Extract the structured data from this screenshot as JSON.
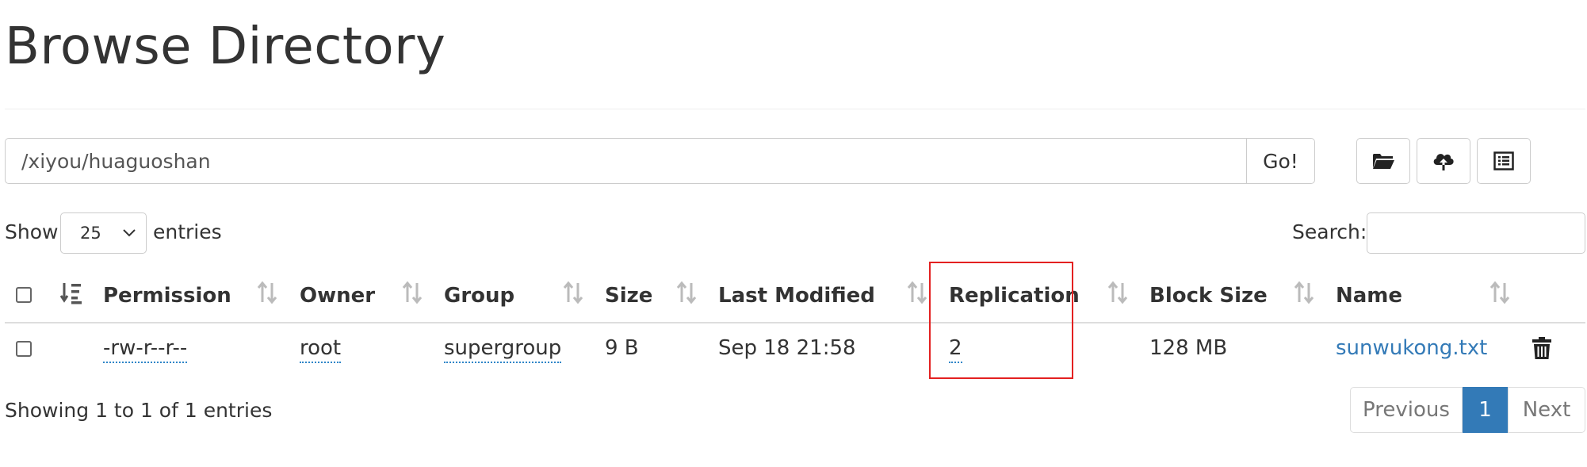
{
  "page": {
    "title": "Browse Directory"
  },
  "toolbar": {
    "path_value": "/xiyou/huaguoshan",
    "go_label": "Go!",
    "icons": [
      "folder-open-icon",
      "cloud-upload-icon",
      "list-alt-icon"
    ]
  },
  "controls": {
    "show_label": "Show",
    "page_length": "25",
    "entries_label": "entries",
    "search_label": "Search:",
    "search_value": ""
  },
  "table": {
    "headers": [
      "Permission",
      "Owner",
      "Group",
      "Size",
      "Last Modified",
      "Replication",
      "Block Size",
      "Name"
    ],
    "rows": [
      {
        "permission": "-rw-r--r--",
        "owner": "root",
        "group": "supergroup",
        "size": "9 B",
        "last_modified": "Sep 18 21:58",
        "replication": "2",
        "block_size": "128 MB",
        "name": "sunwukong.txt"
      }
    ]
  },
  "footer": {
    "info": "Showing 1 to 1 of 1 entries",
    "previous": "Previous",
    "current_page": "1",
    "next": "Next"
  },
  "colors": {
    "accent": "#337ab7",
    "highlight_border": "#e32121",
    "text": "#333333"
  }
}
